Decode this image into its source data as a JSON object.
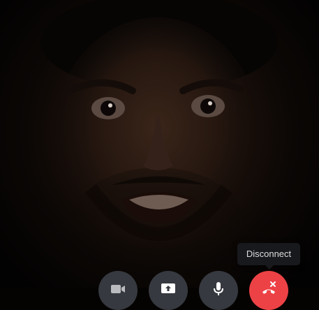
{
  "tooltip": {
    "text": "Disconnect"
  },
  "controls": [
    {
      "name": "toggle-video-button",
      "icon": "video-camera-icon",
      "color": "#36393f"
    },
    {
      "name": "screen-share-button",
      "icon": "screen-share-icon",
      "color": "#36393f"
    },
    {
      "name": "microphone-button",
      "icon": "microphone-icon",
      "color": "#36393f"
    },
    {
      "name": "disconnect-button",
      "icon": "disconnect-icon",
      "color": "#ed4245"
    }
  ],
  "colors": {
    "tooltip_background": "#18191c",
    "tooltip_text": "#dcddde",
    "control_background": "#36393f",
    "disconnect_red": "#ed4245"
  }
}
